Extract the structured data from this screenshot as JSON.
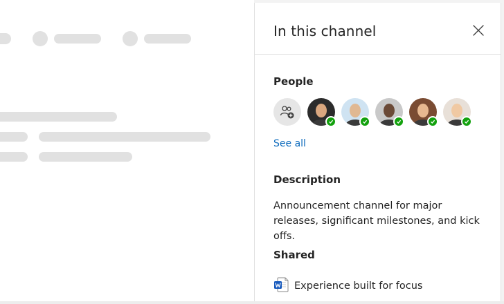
{
  "panel": {
    "title": "In this channel",
    "close_icon": "close-icon"
  },
  "people": {
    "label": "People",
    "add_icon": "add-people-icon",
    "members": [
      {
        "name": "member-1",
        "status": "available",
        "bg": "#2b2b2b",
        "face": "#d9a77f"
      },
      {
        "name": "member-2",
        "status": "available",
        "bg": "#cfe3f2",
        "face": "#e0b892"
      },
      {
        "name": "member-3",
        "status": "available",
        "bg": "#c9c9c9",
        "face": "#6b4a37"
      },
      {
        "name": "member-4",
        "status": "available",
        "bg": "#7a4b32",
        "face": "#e7b890"
      },
      {
        "name": "member-5",
        "status": "available",
        "bg": "#e8e0d8",
        "face": "#f0c9a3"
      }
    ],
    "see_all": "See all"
  },
  "description": {
    "label": "Description",
    "text": "Announcement channel for major releases, significant milestones, and kick offs."
  },
  "shared": {
    "label": "Shared",
    "files": [
      {
        "name": "Experience built for focus",
        "icon": "word-doc-icon"
      }
    ]
  },
  "colors": {
    "accent": "#0f6cbd",
    "presence": "#13a10e",
    "placeholder": "#e1e1e1"
  }
}
